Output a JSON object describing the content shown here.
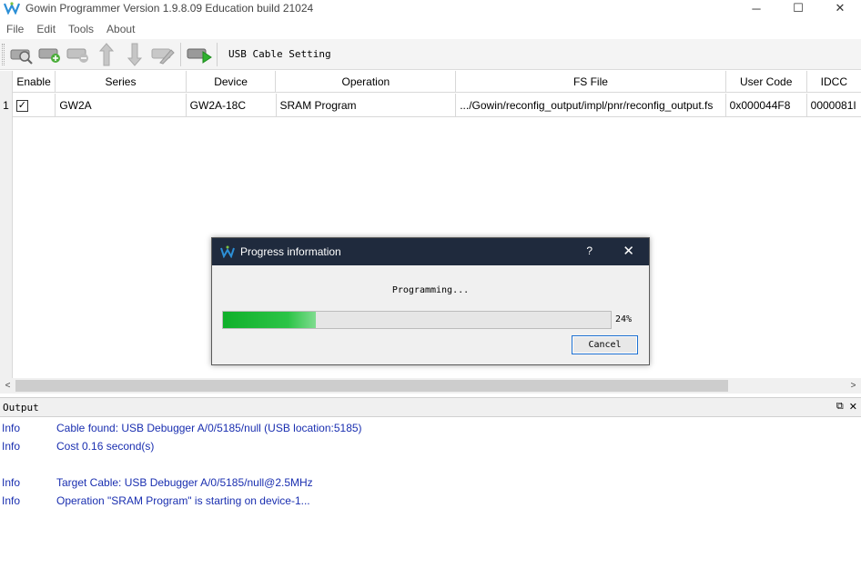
{
  "window": {
    "title": "Gowin Programmer Version 1.9.8.09 Education build 21024",
    "minimize_glyph": "─",
    "maximize_glyph": "☐",
    "close_glyph": "✕"
  },
  "menu": [
    "File",
    "Edit",
    "Tools",
    "About"
  ],
  "toolbar": {
    "icons": [
      "scan-device-icon",
      "add-device-icon",
      "remove-device-icon",
      "move-up-icon",
      "move-down-icon",
      "edit-config-icon",
      "program-run-icon"
    ],
    "cable_setting_label": "USB Cable Setting"
  },
  "table": {
    "headers": {
      "enable": "Enable",
      "series": "Series",
      "device": "Device",
      "operation": "Operation",
      "fs_file": "FS File",
      "user_code": "User Code",
      "idcode": "IDCC"
    },
    "rows": [
      {
        "num": "1",
        "enabled": true,
        "check_glyph": "✓",
        "series": "GW2A",
        "device": "GW2A-18C",
        "operation": "SRAM Program",
        "fs_file": ".../Gowin/reconfig_output/impl/pnr/reconfig_output.fs",
        "user_code": "0x000044F8",
        "idcode": "0000081I"
      }
    ]
  },
  "scrollbar": {
    "left_glyph": "<",
    "right_glyph": ">"
  },
  "output": {
    "title": "Output",
    "float_glyph": "⧉",
    "close_glyph": "✕",
    "lines": [
      {
        "level": "Info",
        "text": "Cable found:  USB Debugger A/0/5185/null (USB location:5185)"
      },
      {
        "level": "Info",
        "text": "Cost 0.16 second(s)"
      },
      {
        "level": "Info",
        "text": "Target Cable: USB Debugger A/0/5185/null@2.5MHz"
      },
      {
        "level": "Info",
        "text": "Operation \"SRAM Program\" is starting on device-1..."
      }
    ]
  },
  "dialog": {
    "title": "Progress information",
    "help_glyph": "?",
    "close_glyph": "✕",
    "status": "Programming...",
    "progress_percent": 24,
    "progress_label": "24%",
    "cancel_label": "Cancel"
  },
  "colors": {
    "log_text": "#1a2fb0",
    "dialog_title_bg": "#1f2a3d",
    "progress_green": "#0fb02a",
    "app_icon_blue": "#2c8fd6"
  }
}
